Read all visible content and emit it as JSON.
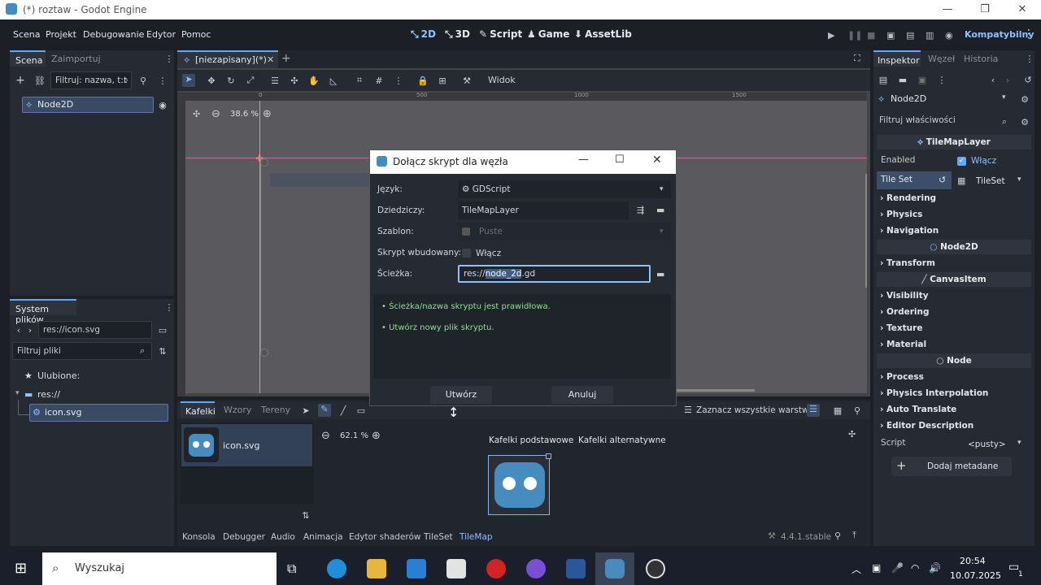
{
  "window": {
    "title": "(*) roztaw - Godot Engine"
  },
  "menu": {
    "items": [
      "Scena",
      "Projekt",
      "Debugowanie",
      "Edytor",
      "Pomoc"
    ]
  },
  "workspaces": [
    "2D",
    "3D",
    "Script",
    "Game",
    "AssetLib"
  ],
  "renderer": "Kompatybilny",
  "scene_dock": {
    "tabs": [
      "Scena",
      "Zaimportuj"
    ],
    "filter_placeholder": "Filtruj: nazwa, t:t",
    "node": "Node2D"
  },
  "filesystem_dock": {
    "tab": "System plików",
    "path": "res://icon.svg",
    "filter_placeholder": "Filtruj pliki",
    "favorites": "Ulubione:",
    "root": "res://",
    "file": "icon.svg"
  },
  "scene_tabs": {
    "active": "[niezapisany](*)"
  },
  "toolbar": {
    "view_menu": "Widok"
  },
  "viewport": {
    "zoom": "38.6 %",
    "ruler_ticks": [
      "0",
      "500",
      "1000",
      "1500"
    ]
  },
  "dialog": {
    "title": "Dołącz skrypt dla węzła",
    "language_label": "Język:",
    "language_value": "GDScript",
    "inherits_label": "Dziedziczy:",
    "inherits_value": "TileMapLayer",
    "template_label": "Szablon:",
    "template_value": "Puste",
    "builtin_label": "Skrypt wbudowany:",
    "builtin_value": "Włącz",
    "path_label": "Ścieżka:",
    "path_prefix": "res://",
    "path_selected": "node_2d",
    "path_suffix": ".gd",
    "messages": [
      "Ścieżka/nazwa skryptu jest prawidłowa.",
      "Utwórz nowy plik skryptu."
    ],
    "create_button": "Utwórz",
    "cancel_button": "Anuluj"
  },
  "tilemap_panel": {
    "tabs": [
      "Kafelki",
      "Wzory",
      "Tereny"
    ],
    "select_all_layers": "Zaznacz wszystkie warstwy",
    "tile_source": "icon.svg",
    "zoom": "62.1 %",
    "atlas_tabs": [
      "Kafelki podstawowe",
      "Kafelki alternatywne"
    ]
  },
  "bottom_tabs": [
    "Konsola",
    "Debugger",
    "Audio",
    "Animacja",
    "Edytor shaderów",
    "TileSet",
    "TileMap"
  ],
  "version": "4.4.1.stable",
  "inspector": {
    "tabs": [
      "Inspektor",
      "Węzeł",
      "Historia"
    ],
    "node": "Node2D",
    "filter_placeholder": "Filtruj właściwości",
    "class_tilemaplayer": "TileMapLayer",
    "enabled_label": "Enabled",
    "enabled_value": "Włącz",
    "tileset_label": "Tile Set",
    "tileset_value": "TileSet",
    "groups1": [
      "Rendering",
      "Physics",
      "Navigation"
    ],
    "class_node2d": "Node2D",
    "groups2": [
      "Transform"
    ],
    "class_canvasitem": "CanvasItem",
    "groups3": [
      "Visibility",
      "Ordering",
      "Texture",
      "Material"
    ],
    "class_node": "Node",
    "groups4": [
      "Process",
      "Physics Interpolation",
      "Auto Translate",
      "Editor Description"
    ],
    "script_label": "Script",
    "script_value": "<pusty>",
    "add_metadata": "Dodaj metadane"
  },
  "taskbar": {
    "search_placeholder": "Wyszukaj",
    "time": "20:54",
    "date": "10.07.2025",
    "notification_count": "1"
  },
  "colors": {
    "accent": "#5fa8ff",
    "success": "#8fe08f",
    "panel": "#262a33",
    "background": "#1c1f26"
  }
}
